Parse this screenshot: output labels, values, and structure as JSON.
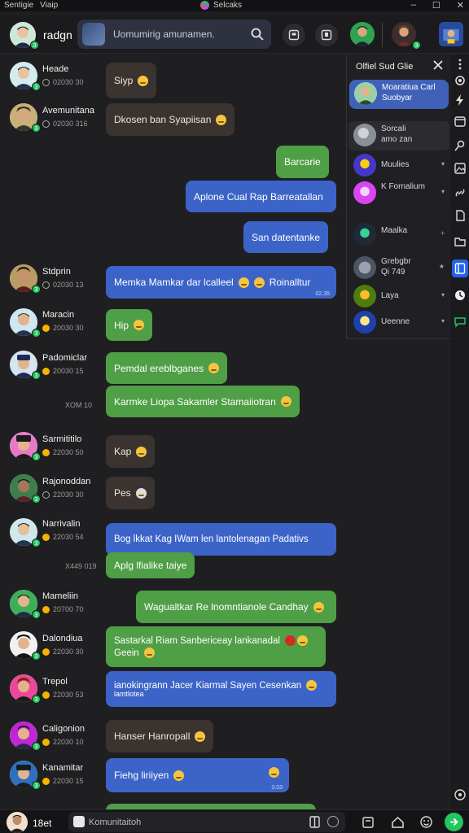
{
  "titlebar": {
    "left1": "Sentigie",
    "left2": "Viaip",
    "title": "Selcaks"
  },
  "header": {
    "me_name": "radgn",
    "search_placeholder": "Uomumirig amunamen."
  },
  "panel": {
    "title": "Olfiel Sud Glie",
    "items": [
      {
        "line1": "Moaratiua Carl",
        "line2": "Suobyar"
      },
      {
        "line1": "Sorcali",
        "line2": "amo zan"
      },
      {
        "line1": "Muulies",
        "line2": ""
      },
      {
        "line1": "K Fornalium",
        "line2": ""
      },
      {
        "line1": "Maalka",
        "line2": ""
      },
      {
        "line1": "Grebgbr",
        "line2": "Qi 749"
      },
      {
        "line1": "Laya",
        "line2": ""
      },
      {
        "line1": "Ueenne",
        "line2": ""
      }
    ]
  },
  "messages": [
    {
      "name": "Heade",
      "time": "02030 30",
      "status": "clock",
      "text": "Siyp",
      "color": "dark"
    },
    {
      "name": "Avemunitana",
      "time": "02030 316",
      "status": "clock",
      "text": "Dkosen ban Syapiisan",
      "color": "dark"
    },
    {
      "text": "Barcarie",
      "color": "green"
    },
    {
      "text": "Aplone Cual Rap Barreatallan",
      "color": "blue"
    },
    {
      "text": "San datentanke",
      "color": "blue"
    },
    {
      "name": "Stdprin",
      "time": "02030 13",
      "status": "clock",
      "text": "Memka Mamkar dar lcalleel",
      "text2": "Roinalltur",
      "ts": "02.35",
      "color": "blue"
    },
    {
      "name": "Maracin",
      "time": "20030 30",
      "status": "emo",
      "text": "Hip",
      "color": "green"
    },
    {
      "name": "Padomiclar",
      "time": "20030 15",
      "status": "emo",
      "text": "Pemdal ereblbganes",
      "color": "green"
    },
    {
      "side_time": "XOM 10",
      "text": "Karmke Liopa Sakamler Stamaiiotran",
      "color": "green"
    },
    {
      "name": "Sarmititilo",
      "time": "22030 50",
      "status": "emo",
      "text": "Kap",
      "color": "dark"
    },
    {
      "name": "Rajonoddan",
      "time": "22030 30",
      "status": "clock",
      "text": "Pes",
      "color": "dark"
    },
    {
      "name": "Narrivalin",
      "time": "22030 54",
      "status": "emo",
      "text": "Bog lkkat Kag IWam len lantolenagan Padativs",
      "color": "blue"
    },
    {
      "side_time": "X449 019",
      "text": "Aplg lfialike taiye",
      "color": "green"
    },
    {
      "name": "Mameliin",
      "time": "20700 70",
      "status": "emo",
      "text": "Wagualtkar Re lnomntianole Candhay",
      "color": "green"
    },
    {
      "name": "Dalondiua",
      "time": "22030 30",
      "status": "emo",
      "text": "Sastarkal Riam Sanbericeay lankanadal",
      "text2": "Geein",
      "color": "green"
    },
    {
      "name": "Trepol",
      "time": "22030 53",
      "status": "emo",
      "text": "ianokingrann Jacer Kiarmal Sayen Cesenkan",
      "text2": "lamtlotea",
      "color": "blue"
    },
    {
      "name": "Caligonion",
      "time": "22030 10",
      "status": "emo",
      "text": "Hanser Hanropall",
      "color": "dark"
    },
    {
      "name": "Kanamitar",
      "time": "22030 15",
      "status": "emo",
      "text": "Fiehg liriiyen",
      "ts": "3.03",
      "color": "blue"
    }
  ],
  "bottom": {
    "me_name": "18et",
    "compose_placeholder": "Komunitaitoh"
  },
  "colors": {
    "green": "#4f9f46",
    "blue": "#3c64c8",
    "dark": "#3a3330",
    "accent": "#22c55e"
  }
}
